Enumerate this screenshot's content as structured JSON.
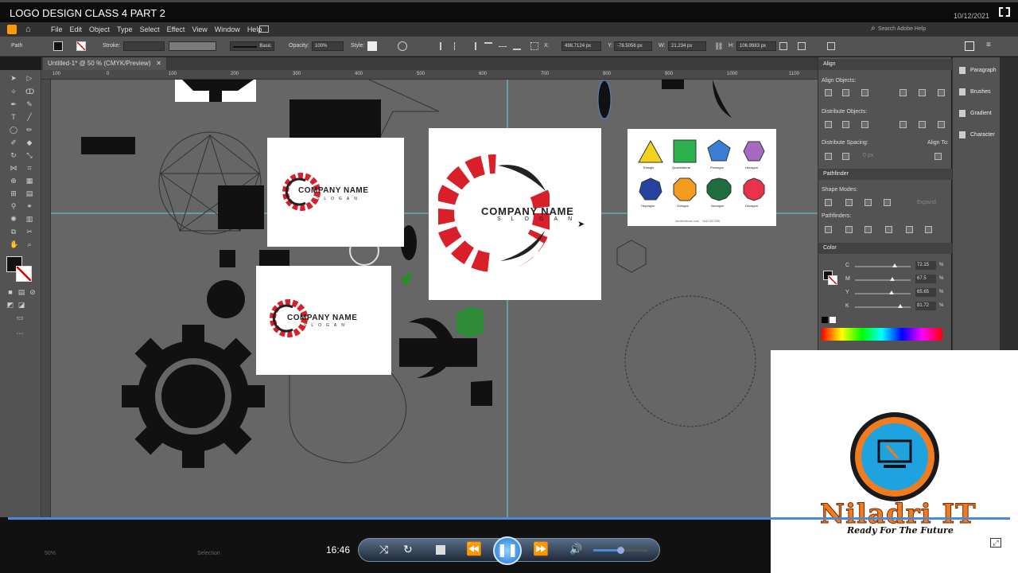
{
  "video": {
    "title": "LOGO DESIGN CLASS 4 PART 2",
    "date": "10/12/2021"
  },
  "menu": [
    "File",
    "Edit",
    "Object",
    "Type",
    "Select",
    "Effect",
    "View",
    "Window",
    "Help"
  ],
  "control": {
    "path_label": "Path",
    "stroke_label": "Stroke:",
    "basic_label": "Basic",
    "opacity_label": "Opacity:",
    "opacity_value": "100%",
    "style_label": "Style:",
    "x_label": "X:",
    "x_value": "498.7124 px",
    "y_label": "Y:",
    "y_value": "-78.5056 px",
    "w_label": "W:",
    "w_value": "21.234 px",
    "h_label": "H:",
    "h_value": "106.9983 px",
    "search_placeholder": "Search Adobe Help"
  },
  "document": {
    "tab": "Untitled-1* @ 50 % (CMYK/Preview)"
  },
  "ruler": [
    "100",
    "0",
    "100",
    "200",
    "300",
    "400",
    "500",
    "600",
    "700",
    "800",
    "900",
    "1000",
    "1100",
    "1200"
  ],
  "panels": {
    "align": {
      "title": "Align",
      "objects": "Align Objects:",
      "distribute": "Distribute Objects:",
      "spacing": "Distribute Spacing:",
      "align_to": "Align To:",
      "spacing_value": "0 px"
    },
    "pathfinder": {
      "title": "Pathfinder",
      "shape_modes": "Shape Modes:",
      "pathfinders": "Pathfinders:",
      "expand": "Expand"
    },
    "color": {
      "title": "Color",
      "channels": [
        {
          "name": "C",
          "value": "72.15",
          "fill": 0.72
        },
        {
          "name": "M",
          "value": "67.5",
          "fill": 0.675
        },
        {
          "name": "Y",
          "value": "65.65",
          "fill": 0.66
        },
        {
          "name": "K",
          "value": "81.72",
          "fill": 0.82
        }
      ],
      "percent": "%"
    }
  },
  "dock": [
    "Paragraph",
    "Brushes",
    "Gradient",
    "Character"
  ],
  "artboards": {
    "company": "COMPANY NAME",
    "slogan": "SLOGAN",
    "stock": "shutterstock.com · 1847437255"
  },
  "shapes": [
    {
      "name": "Triangle",
      "color": "#f2d21c"
    },
    {
      "name": "Quadrilateral",
      "color": "#2bb24c"
    },
    {
      "name": "Pentagon",
      "color": "#3a7fd5"
    },
    {
      "name": "Hexagon",
      "color": "#a56bc2"
    },
    {
      "name": "Heptagon",
      "color": "#25429e"
    },
    {
      "name": "Octagon",
      "color": "#f39c1f"
    },
    {
      "name": "Nonagon",
      "color": "#1d6d3e"
    },
    {
      "name": "Decagon",
      "color": "#e8334a"
    }
  ],
  "brand": {
    "name": "Niladri IT",
    "tagline": "Ready For The Future"
  },
  "player": {
    "time": "16:46"
  },
  "status": {
    "zoom": "50%",
    "mode": "Selection"
  },
  "colors": {
    "accent": "#4a8bd6",
    "gear_red": "#d91f2a"
  }
}
